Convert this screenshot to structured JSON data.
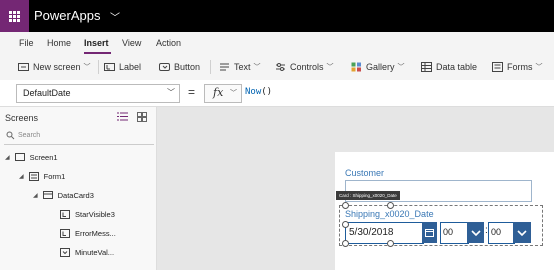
{
  "app": {
    "title": "PowerApps"
  },
  "menu": [
    {
      "label": "File"
    },
    {
      "label": "Home"
    },
    {
      "label": "Insert"
    },
    {
      "label": "View"
    },
    {
      "label": "Action"
    }
  ],
  "toolbar": {
    "new_screen": "New screen",
    "label": "Label",
    "button": "Button",
    "text": "Text",
    "controls": "Controls",
    "gallery": "Gallery",
    "data_table": "Data table",
    "forms": "Forms"
  },
  "formula_bar": {
    "property": "DefaultDate",
    "equals": "=",
    "fx": "fx",
    "function_name": "Now",
    "parens": "()"
  },
  "screens_panel": {
    "title": "Screens",
    "search_placeholder": "Search",
    "tree": [
      {
        "label": "Screen1"
      },
      {
        "label": "Form1"
      },
      {
        "label": "DataCard3"
      },
      {
        "label": "StarVisible3"
      },
      {
        "label": "ErrorMess..."
      },
      {
        "label": "MinuteVal..."
      }
    ]
  },
  "form": {
    "customer_label": "Customer",
    "tooltip": "Card : Shipping_x0020_Date",
    "shipping_label": "Shipping_x0020_Date",
    "date_value": "5/30/2018",
    "hour_value": "00",
    "colon": ":",
    "minute_value": "00"
  },
  "colors": {
    "brand": "#742774",
    "accent_blue": "#2f5f96",
    "label_blue": "#3a78b5"
  }
}
